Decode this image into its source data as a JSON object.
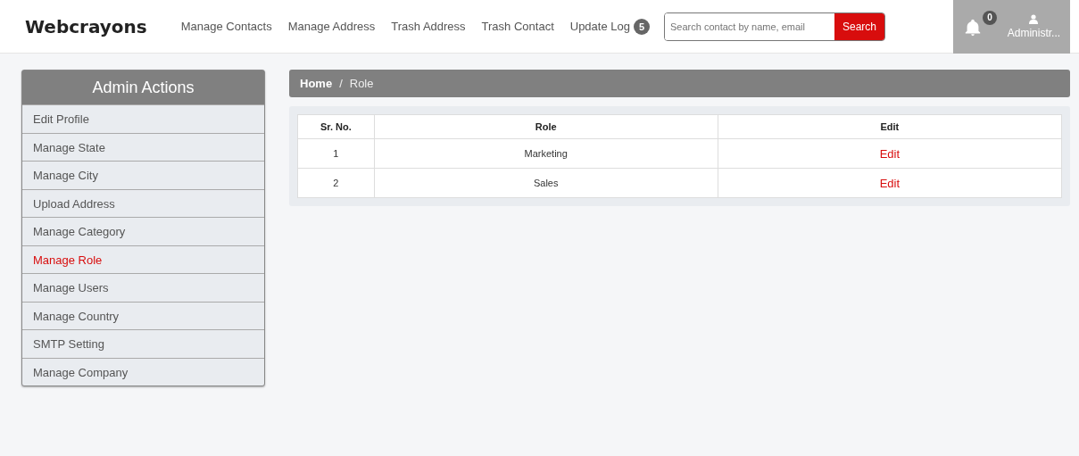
{
  "brand": "Webcrayons",
  "nav": [
    {
      "label": "Manage Contacts"
    },
    {
      "label": "Manage Address"
    },
    {
      "label": "Trash Address"
    },
    {
      "label": "Trash Contact"
    },
    {
      "label": "Update Log",
      "badge": "5"
    }
  ],
  "search": {
    "placeholder": "Search contact by name, email",
    "button": "Search"
  },
  "notifications": {
    "count": "0"
  },
  "user": {
    "name": "Administr..."
  },
  "sidebar": {
    "title": "Admin Actions",
    "items": [
      {
        "label": "Edit Profile",
        "selected": false
      },
      {
        "label": "Manage State",
        "selected": false
      },
      {
        "label": "Manage City",
        "selected": false
      },
      {
        "label": "Upload Address",
        "selected": false
      },
      {
        "label": "Manage Category",
        "selected": false
      },
      {
        "label": "Manage Role",
        "selected": true
      },
      {
        "label": "Manage Users",
        "selected": false
      },
      {
        "label": "Manage Country",
        "selected": false
      },
      {
        "label": "SMTP Setting",
        "selected": false
      },
      {
        "label": "Manage Company",
        "selected": false
      }
    ]
  },
  "breadcrumb": {
    "home": "Home",
    "separator": "/",
    "current": "Role"
  },
  "table": {
    "columns": [
      "Sr. No.",
      "Role",
      "Edit"
    ],
    "rows": [
      {
        "sr": "1",
        "role": "Marketing",
        "edit": "Edit"
      },
      {
        "sr": "2",
        "role": "Sales",
        "edit": "Edit"
      }
    ]
  }
}
